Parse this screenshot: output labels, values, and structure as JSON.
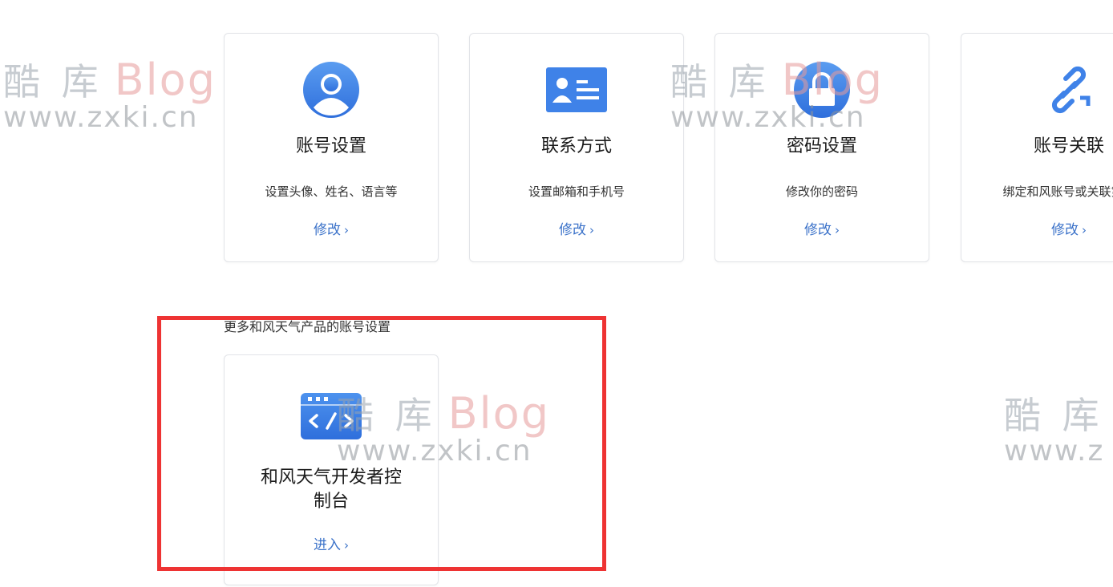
{
  "cards": [
    {
      "title": "账号设置",
      "desc": "设置头像、姓名、语言等",
      "link": "修改",
      "icon": "user-avatar-icon"
    },
    {
      "title": "联系方式",
      "desc": "设置邮箱和手机号",
      "link": "修改",
      "icon": "contact-card-icon"
    },
    {
      "title": "密码设置",
      "desc": "修改你的密码",
      "link": "修改",
      "icon": "lock-icon"
    },
    {
      "title": "账号关联",
      "desc": "绑定和风账号或关联第三",
      "link": "修改",
      "icon": "link-icon"
    }
  ],
  "section_label": "更多和风天气产品的账号设置",
  "console_card": {
    "title": "和风天气开发者控制台",
    "link": "进入",
    "icon": "code-window-icon"
  },
  "chevron": "›",
  "watermark": {
    "cn": "酷 库",
    "blog": "Blog",
    "url": "www.zxki.cn",
    "url_partial": "www.z"
  },
  "colors": {
    "accent": "#3b72c9",
    "icon_blue": "#3f82e8",
    "highlight": "#ee3333"
  }
}
